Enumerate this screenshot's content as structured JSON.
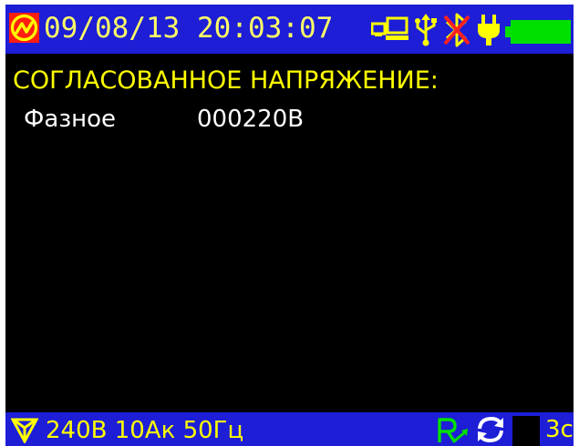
{
  "status_bar": {
    "datetime": "09/08/13 20:03:07",
    "icons": [
      "logo-icon",
      "network-pc-icon",
      "usb-icon",
      "no-bluetooth-icon",
      "power-plug-icon",
      "battery-icon"
    ],
    "battery_level": 1.0
  },
  "main": {
    "title": "СОГЛАСОВАННОЕ НАПРЯЖЕНИЕ:",
    "rows": [
      {
        "label": "Фазное",
        "value": "000220В"
      }
    ]
  },
  "footer": {
    "params": "240В 10Ак 50Гц",
    "timer": "3с",
    "icons": [
      "wiring-triangle-icon",
      "rotation-r-icon",
      "refresh-icon"
    ]
  },
  "colors": {
    "bar_bg": "#1d1ed6",
    "screen_bg": "#000000",
    "title_yellow": "#ffff00",
    "text_white": "#ffffff",
    "battery_green": "#00e000"
  }
}
